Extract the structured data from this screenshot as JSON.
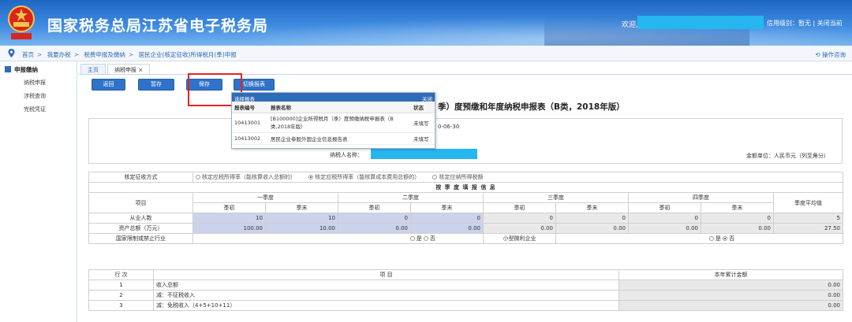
{
  "header": {
    "site_title": "国家税务总局江苏省电子税务局",
    "welcome": "欢迎,",
    "credit_rating": "信用级别：暂无",
    "close": "关闭当前"
  },
  "breadcrumb": {
    "items": [
      "首页",
      "我要办税",
      "税费申报及缴纳",
      "居民企业(核定征收)所得税月(季)申报"
    ],
    "help": "操作咨询"
  },
  "sidebar": {
    "title": "申报缴纳",
    "items": [
      "纳税申报",
      "涉税查询",
      "完税凭证"
    ]
  },
  "tabs": [
    "主页",
    "纳税申报 ×"
  ],
  "toolbar": {
    "back": "返回",
    "draft": "暂存",
    "save": "保存",
    "switch": "切换报表"
  },
  "report_panel": {
    "title": "选择报表",
    "close": "关闭",
    "headers": [
      "报表编号",
      "报表名称",
      "状态"
    ],
    "rows": [
      {
        "code": "10413001",
        "name": "[B100000]企业所得税月（季）度预缴纳税申报表（B类,2018年版）",
        "status": "未填写"
      },
      {
        "code": "10413002",
        "name": "居民企业参股外国企业信息报告表",
        "status": "未填写"
      }
    ]
  },
  "form": {
    "title": "季）度预缴和年度纳税申报表（B类，2018年版）",
    "period_partial": "0-06-30",
    "taxpayer_label": "纳税人名称：",
    "amount_unit": "金额单位：人民币元（列至角分）"
  },
  "levy": {
    "label": "核定征收方式",
    "options": [
      "核定应税所得率（能核算收入总额的）",
      "核定应税所得率（能核算成本费用总额的）",
      "核定应纳所得税额"
    ],
    "selected_index": 1
  },
  "quarterly": {
    "section_title": "按 季 度 填 报 信 息",
    "item_label": "项目",
    "quarters": [
      "一季度",
      "二季度",
      "三季度",
      "四季度"
    ],
    "sub": [
      "季初",
      "季末"
    ],
    "avg_label": "季度平均值",
    "rows": [
      {
        "label": "从业人数",
        "values": [
          "10",
          "10",
          "0",
          "0",
          "0",
          "0",
          "0",
          "0"
        ],
        "avg": "5"
      },
      {
        "label": "资产总额（万元）",
        "values": [
          "100.00",
          "10.00",
          "0.00",
          "0.00",
          "0.00",
          "0.00",
          "0.00",
          "0.00"
        ],
        "avg": "27.50"
      }
    ],
    "restricted_label": "国家限制或禁止行业",
    "small_label": "小型微利企业",
    "yes": "是",
    "no": "否"
  },
  "income": {
    "headers": [
      "行 次",
      "项 目",
      "本年累计金额"
    ],
    "rows": [
      {
        "no": "1",
        "item": "收入总额",
        "amount": "0.00"
      },
      {
        "no": "2",
        "item": "减：不征税收入",
        "amount": "0.00"
      },
      {
        "no": "3",
        "item": "减：免税收入（4+5+10+11）",
        "amount": "0.00"
      }
    ]
  },
  "colors": {
    "banner": "#2f73c9",
    "button": "#2f73c9",
    "highlight": "#e32424",
    "mask": "#26b6f0",
    "input_cell": "#cbd3ec"
  }
}
